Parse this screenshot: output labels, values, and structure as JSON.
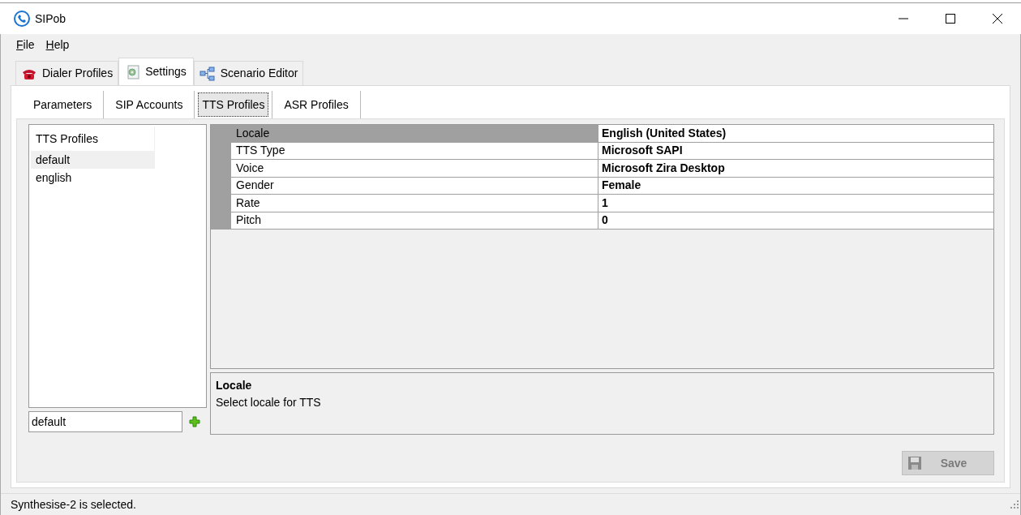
{
  "window": {
    "title": "SIPob"
  },
  "menu": [
    "File",
    "Help"
  ],
  "main_tabs": [
    {
      "label": "Dialer Profiles",
      "kind": "phone",
      "selected": false
    },
    {
      "label": "Settings",
      "kind": "settings",
      "selected": true
    },
    {
      "label": "Scenario Editor",
      "kind": "diagram",
      "selected": false
    }
  ],
  "sub_tabs": [
    {
      "label": "Parameters",
      "selected": false
    },
    {
      "label": "SIP Accounts",
      "selected": false
    },
    {
      "label": "TTS Profiles",
      "selected": true
    },
    {
      "label": "ASR Profiles",
      "selected": false
    }
  ],
  "profiles": {
    "header": "TTS Profiles",
    "items": [
      {
        "label": "default",
        "selected": true
      },
      {
        "label": "english",
        "selected": false
      }
    ],
    "name_field": "default"
  },
  "properties": [
    {
      "name": "Locale",
      "value": "English (United States)",
      "selected": true
    },
    {
      "name": "TTS Type",
      "value": "Microsoft SAPI",
      "selected": false
    },
    {
      "name": "Voice",
      "value": "Microsoft Zira Desktop",
      "selected": false
    },
    {
      "name": "Gender",
      "value": "Female",
      "selected": false
    },
    {
      "name": "Rate",
      "value": "1",
      "selected": false
    },
    {
      "name": "Pitch",
      "value": "0",
      "selected": false
    }
  ],
  "description": {
    "title": "Locale",
    "text": "Select locale for TTS"
  },
  "save_button": {
    "label": "Save",
    "disabled": true
  },
  "status_bar": "Synthesise-2 is selected."
}
